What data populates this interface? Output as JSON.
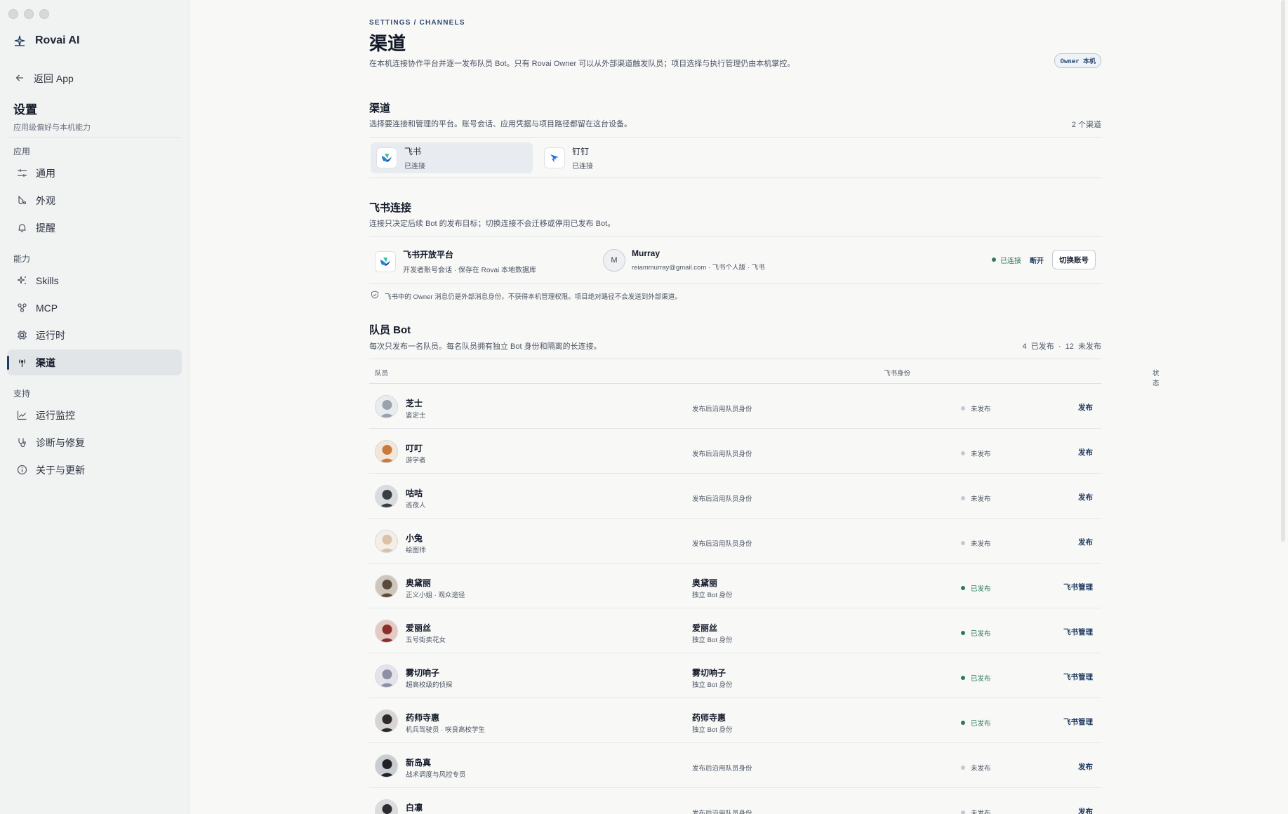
{
  "app": {
    "name": "Rovai AI"
  },
  "sidebar": {
    "back_label": "返回 App",
    "title": "设置",
    "subtitle": "应用级偏好与本机能力",
    "groups": [
      {
        "label": "应用",
        "items": [
          {
            "label": "通用",
            "icon": "sliders-icon"
          },
          {
            "label": "外观",
            "icon": "palette-icon"
          },
          {
            "label": "提醒",
            "icon": "bell-icon"
          }
        ]
      },
      {
        "label": "能力",
        "items": [
          {
            "label": "Skills",
            "icon": "sparkle-icon"
          },
          {
            "label": "MCP",
            "icon": "nodes-icon"
          },
          {
            "label": "运行时",
            "icon": "chip-icon"
          },
          {
            "label": "渠道",
            "icon": "antenna-icon",
            "active": true
          }
        ]
      },
      {
        "label": "支持",
        "items": [
          {
            "label": "运行监控",
            "icon": "chart-icon"
          },
          {
            "label": "诊断与修复",
            "icon": "stethoscope-icon"
          },
          {
            "label": "关于与更新",
            "icon": "info-icon"
          }
        ]
      }
    ]
  },
  "header": {
    "breadcrumb": "SETTINGS / CHANNELS",
    "title": "渠道",
    "description": "在本机连接协作平台并逐一发布队员 Bot。只有 Rovai Owner 可以从外部渠道触发队员；项目选择与执行管理仍由本机掌控。",
    "badge": "Owner 本机"
  },
  "channels": {
    "title": "渠道",
    "description": "选择要连接和管理的平台。账号会话、应用凭据与项目路径都留在这台设备。",
    "count": "2 个渠道",
    "tabs": [
      {
        "name": "飞书",
        "status": "已连接"
      },
      {
        "name": "钉钉",
        "status": "已连接"
      }
    ]
  },
  "connection": {
    "title": "飞书连接",
    "description": "连接只决定后续 Bot 的发布目标；切换连接不会迁移或停用已发布 Bot。",
    "platform_title": "飞书开放平台",
    "platform_sub": "开发者账号会话 · 保存在 Rovai 本地数据库",
    "user_initial": "M",
    "user_name": "Murray",
    "user_sub": "reiammurray@gmail.com · 飞书个人版 · 飞书",
    "status": "已连接",
    "disconnect": "断开",
    "switch": "切换账号",
    "note": "飞书中的 Owner 消息仍是外部消息身份，不获得本机管理权限。项目绝对路径不会发送到外部渠道。"
  },
  "bots": {
    "title": "队员 Bot",
    "description": "每次只发布一名队员。每名队员拥有独立 Bot 身份和隔离的长连接。",
    "published_count": "4  已发布",
    "sep": "·",
    "unpublished_count": "12  未发布",
    "columns": {
      "member": "队员",
      "identity": "飞书身份",
      "status": "状态"
    },
    "rows": [
      {
        "name": "芝士",
        "role": "鉴定士",
        "identity": "发布后沿用队员身份",
        "identity_sub": "",
        "status": "未发布",
        "published": false,
        "action": "发布",
        "avatar_color": "#9aa3ad",
        "avatar_bg": "#e9ecef"
      },
      {
        "name": "叮叮",
        "role": "游学者",
        "identity": "发布后沿用队员身份",
        "identity_sub": "",
        "status": "未发布",
        "published": false,
        "action": "发布",
        "avatar_color": "#c97a3c",
        "avatar_bg": "#f3e6da"
      },
      {
        "name": "咕咕",
        "role": "巡夜人",
        "identity": "发布后沿用队员身份",
        "identity_sub": "",
        "status": "未发布",
        "published": false,
        "action": "发布",
        "avatar_color": "#3a3f46",
        "avatar_bg": "#d9dcdf"
      },
      {
        "name": "小兔",
        "role": "绘图师",
        "identity": "发布后沿用队员身份",
        "identity_sub": "",
        "status": "未发布",
        "published": false,
        "action": "发布",
        "avatar_color": "#d9c3a8",
        "avatar_bg": "#f4eee6"
      },
      {
        "name": "奥黛丽",
        "role": "正义小姐 · 观众途径",
        "identity": "奥黛丽",
        "identity_sub": "独立 Bot 身份",
        "status": "已发布",
        "published": true,
        "action": "飞书管理",
        "avatar_color": "#5a4a3c",
        "avatar_bg": "#cfc6bb"
      },
      {
        "name": "爱丽丝",
        "role": "五号街卖花女",
        "identity": "爱丽丝",
        "identity_sub": "独立 Bot 身份",
        "status": "已发布",
        "published": true,
        "action": "飞书管理",
        "avatar_color": "#8a2f2a",
        "avatar_bg": "#e5c9c3"
      },
      {
        "name": "雾切响子",
        "role": "超高校级的侦探",
        "identity": "雾切响子",
        "identity_sub": "独立 Bot 身份",
        "status": "已发布",
        "published": true,
        "action": "飞书管理",
        "avatar_color": "#8d8fa3",
        "avatar_bg": "#e3e3ea"
      },
      {
        "name": "药师寺惠",
        "role": "机兵驾驶员 · 咲良高校学生",
        "identity": "药师寺惠",
        "identity_sub": "独立 Bot 身份",
        "status": "已发布",
        "published": true,
        "action": "飞书管理",
        "avatar_color": "#2d2a2a",
        "avatar_bg": "#d8d4d2"
      },
      {
        "name": "新岛真",
        "role": "战术调度与风控专员",
        "identity": "发布后沿用队员身份",
        "identity_sub": "",
        "status": "未发布",
        "published": false,
        "action": "发布",
        "avatar_color": "#1f2226",
        "avatar_bg": "#c9ccd0"
      },
      {
        "name": "白凛",
        "role": "",
        "identity": "发布后沿用队员身份",
        "identity_sub": "",
        "status": "未发布",
        "published": false,
        "action": "发布",
        "avatar_color": "#2b2d31",
        "avatar_bg": "#dcdcdc"
      }
    ]
  }
}
